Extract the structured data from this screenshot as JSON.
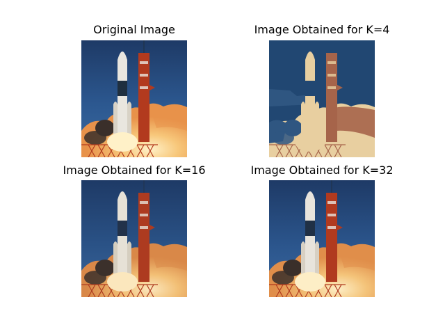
{
  "panels": [
    {
      "title": "Original Image",
      "variant": "original",
      "palette": {
        "sky_top": "#1e3a66",
        "sky_mid": "#2c5890",
        "sky_low": "#3b6aa0",
        "plume_light": "#fff1c8",
        "plume_mid": "#f7c77a",
        "plume_dark": "#e8924a",
        "smoke": "#3a2f2a",
        "tower": "#b23a1e",
        "rocket": "#e9e6df",
        "rocket_dark": "#1f2f3f",
        "booster": "#d8d2c6"
      }
    },
    {
      "title": "Image Obtained for K=4",
      "variant": "k4",
      "palette": {
        "sky_top": "#214772",
        "sky_mid": "#214772",
        "sky_low": "#2f5681",
        "plume_light": "#e8cfa0",
        "plume_mid": "#e8cfa0",
        "plume_dark": "#a6644a",
        "smoke": "#2f5681",
        "tower": "#a6644a",
        "rocket": "#e8cfa0",
        "rocket_dark": "#214772",
        "booster": "#e8cfa0"
      }
    },
    {
      "title": "Image Obtained for K=16",
      "variant": "k16",
      "palette": {
        "sky_top": "#1e3a66",
        "sky_mid": "#2a5286",
        "sky_low": "#3a659a",
        "plume_light": "#fbe7bd",
        "plume_mid": "#f2bf75",
        "plume_dark": "#d98848",
        "smoke": "#3b302b",
        "tower": "#ad3b20",
        "rocket": "#e6e1d6",
        "rocket_dark": "#22324a",
        "booster": "#d5cebf"
      }
    },
    {
      "title": "Image Obtained for K=32",
      "variant": "k32",
      "palette": {
        "sky_top": "#1e3a66",
        "sky_mid": "#2b558c",
        "sky_low": "#3b689e",
        "plume_light": "#fdeec6",
        "plume_mid": "#f4c47a",
        "plume_dark": "#e08e4a",
        "smoke": "#3a2f2a",
        "tower": "#b03a1f",
        "rocket": "#e8e4dc",
        "rocket_dark": "#203045",
        "booster": "#d7d0c3"
      }
    }
  ]
}
